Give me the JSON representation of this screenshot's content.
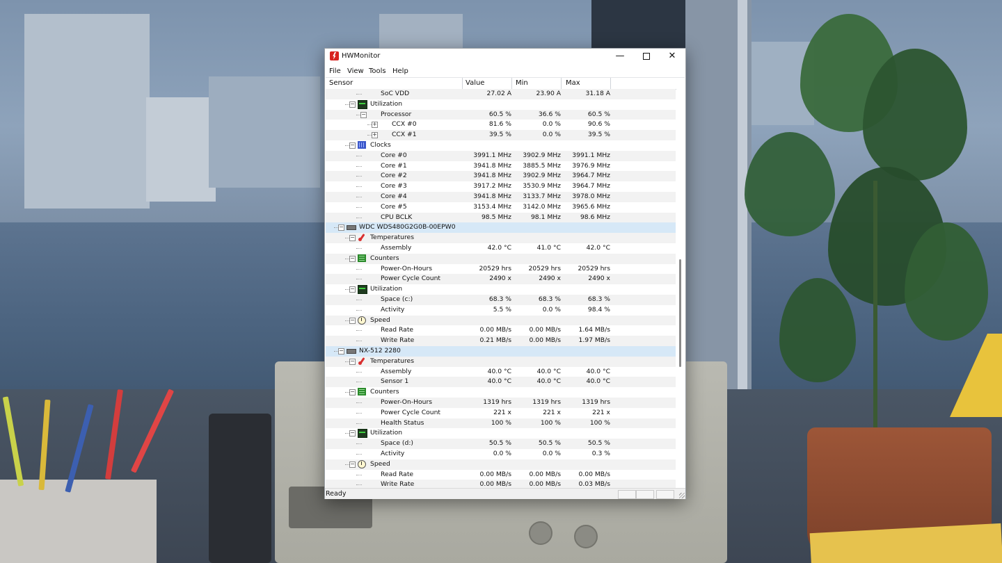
{
  "window": {
    "title": "HWMonitor",
    "minimize_icon": "minimize-icon",
    "maximize_icon": "maximize-icon",
    "close_icon": "close-icon"
  },
  "menu": [
    "File",
    "View",
    "Tools",
    "Help"
  ],
  "columns": {
    "sensor": "Sensor",
    "value": "Value",
    "min": "Min",
    "max": "Max"
  },
  "rows": [
    {
      "label": "SoC VDD",
      "level": 3,
      "value": "27.02 A",
      "min": "23.90 A",
      "max": "31.18 A"
    },
    {
      "label": "Utilization",
      "level": 2,
      "icon": "utilization-icon",
      "expander": "⊟"
    },
    {
      "label": "Processor",
      "level": 3,
      "expander": "⊟",
      "value": "60.5 %",
      "min": "36.6 %",
      "max": "60.5 %"
    },
    {
      "label": "CCX #0",
      "level": 4,
      "expander": "⊞",
      "value": "81.6 %",
      "min": "0.0 %",
      "max": "90.6 %"
    },
    {
      "label": "CCX #1",
      "level": 4,
      "expander": "⊞",
      "value": "39.5 %",
      "min": "0.0 %",
      "max": "39.5 %"
    },
    {
      "label": "Clocks",
      "level": 2,
      "icon": "clock-icon",
      "expander": "⊟"
    },
    {
      "label": "Core #0",
      "level": 3,
      "value": "3991.1 MHz",
      "min": "3902.9 MHz",
      "max": "3991.1 MHz"
    },
    {
      "label": "Core #1",
      "level": 3,
      "value": "3941.8 MHz",
      "min": "3885.5 MHz",
      "max": "3976.9 MHz"
    },
    {
      "label": "Core #2",
      "level": 3,
      "value": "3941.8 MHz",
      "min": "3902.9 MHz",
      "max": "3964.7 MHz"
    },
    {
      "label": "Core #3",
      "level": 3,
      "value": "3917.2 MHz",
      "min": "3530.9 MHz",
      "max": "3964.7 MHz"
    },
    {
      "label": "Core #4",
      "level": 3,
      "value": "3941.8 MHz",
      "min": "3133.7 MHz",
      "max": "3978.0 MHz"
    },
    {
      "label": "Core #5",
      "level": 3,
      "value": "3153.4 MHz",
      "min": "3142.0 MHz",
      "max": "3965.6 MHz"
    },
    {
      "label": "CPU BCLK",
      "level": 3,
      "value": "98.5 MHz",
      "min": "98.1 MHz",
      "max": "98.6 MHz"
    },
    {
      "label": "WDC WDS480G2G0B-00EPW0",
      "level": 1,
      "icon": "drive-icon",
      "expander": "⊟",
      "selected": true
    },
    {
      "label": "Temperatures",
      "level": 2,
      "icon": "thermometer-icon",
      "expander": "⊟"
    },
    {
      "label": "Assembly",
      "level": 3,
      "value": "42.0 °C",
      "min": "41.0 °C",
      "max": "42.0 °C"
    },
    {
      "label": "Counters",
      "level": 2,
      "icon": "counter-icon",
      "expander": "⊟"
    },
    {
      "label": "Power-On-Hours",
      "level": 3,
      "value": "20529 hrs",
      "min": "20529 hrs",
      "max": "20529 hrs"
    },
    {
      "label": "Power Cycle Count",
      "level": 3,
      "value": "2490 x",
      "min": "2490 x",
      "max": "2490 x"
    },
    {
      "label": "Utilization",
      "level": 2,
      "icon": "utilization-icon",
      "expander": "⊟"
    },
    {
      "label": "Space (c:)",
      "level": 3,
      "value": "68.3 %",
      "min": "68.3 %",
      "max": "68.3 %"
    },
    {
      "label": "Activity",
      "level": 3,
      "value": "5.5 %",
      "min": "0.0 %",
      "max": "98.4 %"
    },
    {
      "label": "Speed",
      "level": 2,
      "icon": "speed-icon",
      "expander": "⊟"
    },
    {
      "label": "Read Rate",
      "level": 3,
      "value": "0.00 MB/s",
      "min": "0.00 MB/s",
      "max": "1.64 MB/s"
    },
    {
      "label": "Write Rate",
      "level": 3,
      "value": "0.21 MB/s",
      "min": "0.00 MB/s",
      "max": "1.97 MB/s"
    },
    {
      "label": "NX-512 2280",
      "level": 1,
      "icon": "drive-icon",
      "expander": "⊟",
      "selected": true
    },
    {
      "label": "Temperatures",
      "level": 2,
      "icon": "thermometer-icon",
      "expander": "⊟"
    },
    {
      "label": "Assembly",
      "level": 3,
      "value": "40.0 °C",
      "min": "40.0 °C",
      "max": "40.0 °C"
    },
    {
      "label": "Sensor 1",
      "level": 3,
      "value": "40.0 °C",
      "min": "40.0 °C",
      "max": "40.0 °C"
    },
    {
      "label": "Counters",
      "level": 2,
      "icon": "counter-icon",
      "expander": "⊟"
    },
    {
      "label": "Power-On-Hours",
      "level": 3,
      "value": "1319 hrs",
      "min": "1319 hrs",
      "max": "1319 hrs"
    },
    {
      "label": "Power Cycle Count",
      "level": 3,
      "value": "221 x",
      "min": "221 x",
      "max": "221 x"
    },
    {
      "label": "Health Status",
      "level": 3,
      "value": "100 %",
      "min": "100 %",
      "max": "100 %"
    },
    {
      "label": "Utilization",
      "level": 2,
      "icon": "utilization-icon",
      "expander": "⊟"
    },
    {
      "label": "Space (d:)",
      "level": 3,
      "value": "50.5 %",
      "min": "50.5 %",
      "max": "50.5 %"
    },
    {
      "label": "Activity",
      "level": 3,
      "value": "0.0 %",
      "min": "0.0 %",
      "max": "0.3 %"
    },
    {
      "label": "Speed",
      "level": 2,
      "icon": "speed-icon",
      "expander": "⊟"
    },
    {
      "label": "Read Rate",
      "level": 3,
      "value": "0.00 MB/s",
      "min": "0.00 MB/s",
      "max": "0.00 MB/s"
    },
    {
      "label": "Write Rate",
      "level": 3,
      "value": "0.00 MB/s",
      "min": "0.00 MB/s",
      "max": "0.03 MB/s"
    }
  ],
  "status": {
    "text": "Ready"
  },
  "colors": {
    "selected_row": "#d6e8f7",
    "alt_row": "#f2f2f2",
    "app_icon": "#d8231f"
  }
}
